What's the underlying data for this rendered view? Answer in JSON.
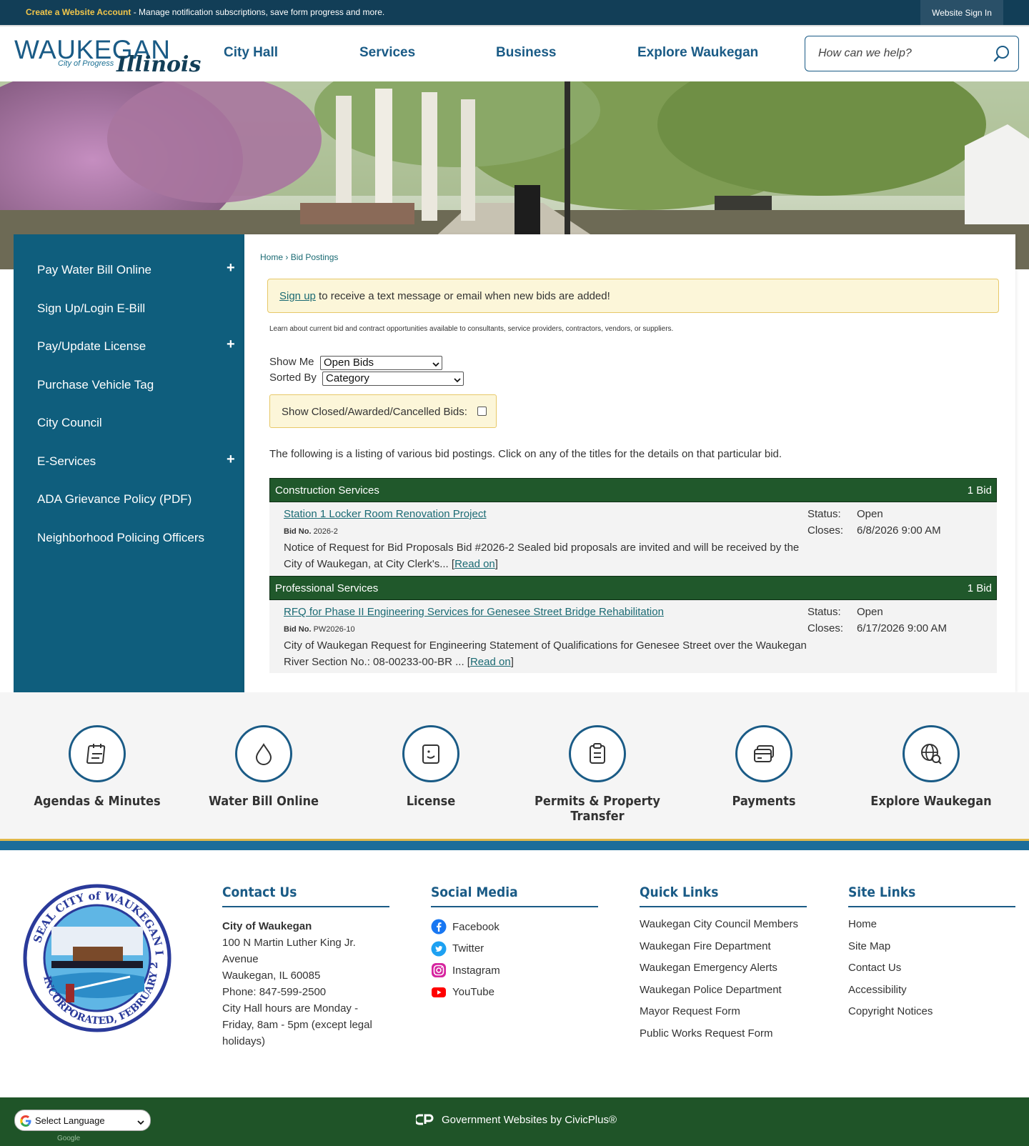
{
  "topbar": {
    "create_label": "Create a Website Account",
    "message": " - Manage notification subscriptions, save form progress and more.",
    "signin_label": "Website Sign In"
  },
  "header": {
    "logo_word": "WAUKEGAN",
    "logo_tagline": "City of Progress",
    "logo_state": "Illinois",
    "nav": [
      "City Hall",
      "Services",
      "Business",
      "Explore Waukegan"
    ],
    "search_placeholder": "How can we help?"
  },
  "sidebar": {
    "items": [
      {
        "label": "Pay Water Bill Online",
        "expandable": true
      },
      {
        "label": "Sign Up/Login E-Bill",
        "expandable": false
      },
      {
        "label": "Pay/Update License",
        "expandable": true
      },
      {
        "label": "Purchase Vehicle Tag",
        "expandable": false
      },
      {
        "label": "City Council",
        "expandable": false
      },
      {
        "label": "E-Services",
        "expandable": true
      },
      {
        "label": "ADA Grievance Policy (PDF)",
        "expandable": false
      },
      {
        "label": "Neighborhood Policing Officers",
        "expandable": false
      }
    ],
    "expand_symbol": "+"
  },
  "main": {
    "breadcrumb": {
      "home": "Home",
      "sep": " › ",
      "current": "Bid Postings"
    },
    "alert": {
      "link": "Sign up",
      "text": " to receive a text message or email when new bids are added!"
    },
    "intro": "Learn about current bid and contract opportunities available to consultants, service providers, contractors, vendors, or suppliers.",
    "show_me": {
      "label": "Show Me",
      "value": "Open Bids"
    },
    "sorted_by": {
      "label": "Sorted By",
      "value": "Category"
    },
    "show_closed": {
      "label": "Show Closed/Awarded/Cancelled Bids:",
      "checked": false
    },
    "listing_text": "The following is a listing of various bid postings. Click on any of the titles for the details on that particular bid.",
    "categories": [
      {
        "name": "Construction Services",
        "count": "1 Bid",
        "bid": {
          "title": "Station 1 Locker Room Renovation Project",
          "bid_no_label": "Bid No.",
          "bid_no": "2026-2",
          "description": "Notice of Request for Bid Proposals Bid #2026-2 Sealed bid proposals are invited and will be received by the City of Waukegan, at City Clerk's... ",
          "read_on": "Read on",
          "status_label": "Status:",
          "status": "Open",
          "closes_label": "Closes:",
          "closes": "6/8/2026 9:00 AM"
        }
      },
      {
        "name": "Professional Services",
        "count": "1 Bid",
        "bid": {
          "title": "RFQ for Phase II Engineering Services for Genesee Street Bridge Rehabilitation",
          "bid_no_label": "Bid No.",
          "bid_no": "PW2026-10",
          "description": "City of Waukegan Request for Engineering Statement of Qualifications for Genesee Street over the Waukegan River Section No.: 08-00233-00-BR ... ",
          "read_on": "Read on",
          "status_label": "Status:",
          "status": "Open",
          "closes_label": "Closes:",
          "closes": "6/17/2026 9:00 AM"
        }
      }
    ]
  },
  "quick_links": [
    {
      "label": "Agendas & Minutes",
      "icon": "agenda-icon"
    },
    {
      "label": "Water Bill Online",
      "icon": "water-drop-icon"
    },
    {
      "label": "License",
      "icon": "license-document-icon"
    },
    {
      "label": "Permits & Property Transfer",
      "icon": "clipboard-icon"
    },
    {
      "label": "Payments",
      "icon": "credit-card-icon"
    },
    {
      "label": "Explore Waukegan",
      "icon": "globe-search-icon"
    }
  ],
  "footer": {
    "contact": {
      "heading": "Contact Us",
      "name": "City of Waukegan",
      "address1": "100 N Martin Luther King Jr.",
      "address2": "Avenue",
      "city": "Waukegan, IL 60085",
      "phone": "Phone: 847-599-2500",
      "hours": "City Hall hours are Monday - Friday, 8am - 5pm (except legal holidays)"
    },
    "social": {
      "heading": "Social Media",
      "items": [
        "Facebook",
        "Twitter",
        "Instagram",
        "YouTube"
      ]
    },
    "quick": {
      "heading": "Quick Links",
      "items": [
        "Waukegan City Council Members",
        "Waukegan Fire Department",
        "Waukegan Emergency Alerts",
        "Waukegan Police Department",
        "Mayor Request Form",
        "Public Works Request Form"
      ]
    },
    "site": {
      "heading": "Site Links",
      "items": [
        "Home",
        "Site Map",
        "Contact Us",
        "Accessibility",
        "Copyright Notices"
      ]
    },
    "language_label": "Select Language",
    "powered_by": "Google",
    "civicplus": "Government Websites by CivicPlus®",
    "seal_text": "SEAL CITY of WAUKEGAN ILLINOIS INCORPORATED, FEBRUARY 23, 1859"
  },
  "colors": {
    "topbar": "#123e57",
    "sidebar": "#0f5e7d",
    "category_bar": "#20582b",
    "footer_bar": "#1f5428",
    "alert_bg": "#fcf6d9",
    "accent_blue": "#1a5b86"
  }
}
